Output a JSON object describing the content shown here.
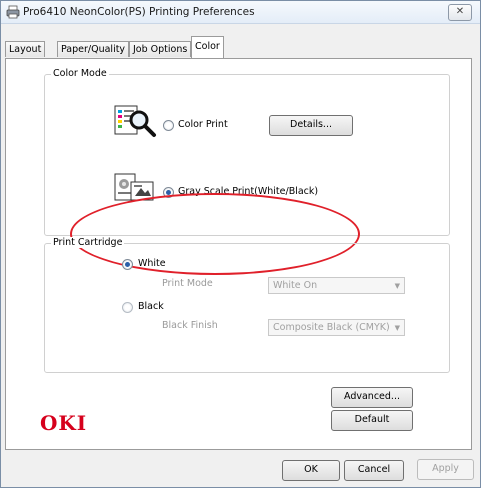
{
  "window": {
    "title": "Pro6410 NeonColor(PS) Printing Preferences",
    "close_glyph": "✕"
  },
  "tabs": [
    {
      "label": "Layout",
      "active": false
    },
    {
      "label": "Paper/Quality",
      "active": false
    },
    {
      "label": "Job Options",
      "active": false
    },
    {
      "label": "Color",
      "active": true
    }
  ],
  "color_mode": {
    "group_label": "Color Mode",
    "color_print": {
      "label": "Color Print",
      "selected": false,
      "icon": "color-document-magnifier-icon"
    },
    "details_button": "Details...",
    "grayscale_print": {
      "label": "Gray Scale Print(White/Black)",
      "selected": true,
      "icon": "grayscale-document-icon"
    }
  },
  "print_cartridge": {
    "group_label": "Print Cartridge",
    "white": {
      "label": "White",
      "selected": true
    },
    "print_mode": {
      "label": "Print Mode",
      "value": "White On"
    },
    "black": {
      "label": "Black",
      "selected": false
    },
    "black_finish": {
      "label": "Black Finish",
      "value": "Composite Black (CMYK)"
    }
  },
  "side_buttons": {
    "advanced": "Advanced...",
    "default": "Default"
  },
  "logo": {
    "text": "OKI",
    "color": "#d6001c"
  },
  "footer_buttons": {
    "ok": "OK",
    "cancel": "Cancel",
    "apply": "Apply"
  },
  "annotation": {
    "color": "#e0202a"
  }
}
